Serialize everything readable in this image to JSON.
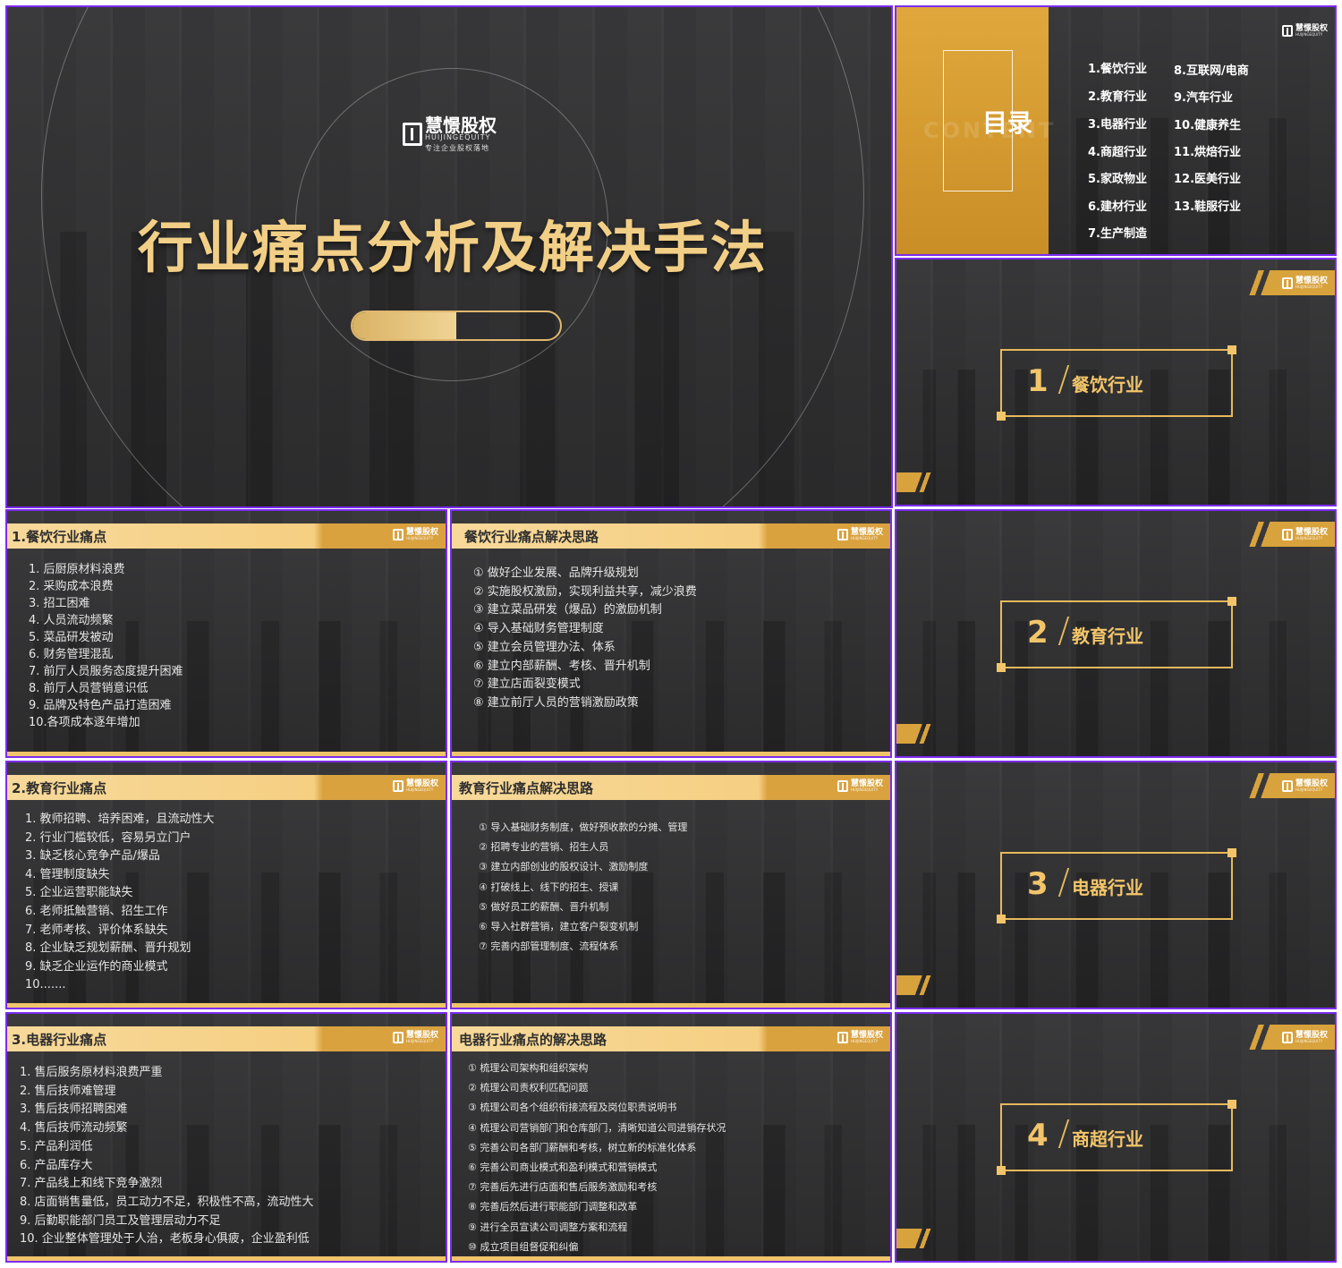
{
  "colors": {
    "accent": "#f2c56a",
    "border": "#7b2cf0",
    "header": "#f7d99a"
  },
  "brand": {
    "name": "慧憬股权",
    "en": "HUIJINGEQUITY",
    "tagline": "专注企业股权落地"
  },
  "title_slide": {
    "title": "行业痛点分析及解决手法",
    "progress": 0.5
  },
  "toc": {
    "title": "目录",
    "ghost": "CONTENT",
    "items": [
      "1.餐饮行业",
      "2.教育行业",
      "3.电器行业",
      "4.商超行业",
      "5.家政物业",
      "6.建材行业",
      "7.生产制造",
      "8.互联网/电商",
      "9.汽车行业",
      "10.健康养生",
      "11.烘焙行业",
      "12.医美行业",
      "13.鞋服行业"
    ]
  },
  "sections": [
    {
      "num": "1",
      "label": "餐饮行业"
    },
    {
      "num": "2",
      "label": "教育行业"
    },
    {
      "num": "3",
      "label": "电器行业"
    },
    {
      "num": "4",
      "label": "商超行业"
    }
  ],
  "catering_pain": {
    "title": "1.餐饮行业痛点",
    "items": [
      "1. 后厨原材料浪费",
      "2. 采购成本浪费",
      "3. 招工困难",
      "4. 人员流动频繁",
      "5. 菜品研发被动",
      "6. 财务管理混乱",
      "7. 前厅人员服务态度提升困难",
      "8. 前厅人员营销意识低",
      "9. 品牌及特色产品打造困难",
      "10.各项成本逐年增加"
    ]
  },
  "catering_solution": {
    "title": "餐饮行业痛点解决思路",
    "items": [
      "① 做好企业发展、品牌升级规划",
      "② 实施股权激励，实现利益共享，减少浪费",
      "③ 建立菜品研发（爆品）的激励机制",
      "④ 导入基础财务管理制度",
      "⑤ 建立会员管理办法、体系",
      "⑥ 建立内部薪酬、考核、晋升机制",
      "⑦ 建立店面裂变模式",
      "⑧ 建立前厅人员的营销激励政策"
    ]
  },
  "education_pain": {
    "title": "2.教育行业痛点",
    "items": [
      "1. 教师招聘、培养困难，且流动性大",
      "2. 行业门槛较低，容易另立门户",
      "3. 缺乏核心竞争产品/爆品",
      "4. 管理制度缺失",
      "5. 企业运营职能缺失",
      "6. 老师抵触营销、招生工作",
      "7. 老师考核、评价体系缺失",
      "8. 企业缺乏规划薪酬、晋升规划",
      "9. 缺乏企业运作的商业模式",
      "10.......  "
    ]
  },
  "education_solution": {
    "title": "教育行业痛点解决思路",
    "items": [
      "① 导入基础财务制度，做好预收款的分摊、管理",
      "② 招聘专业的营销、招生人员",
      "③ 建立内部创业的股权设计、激励制度",
      "④ 打破线上、线下的招生、授课",
      "⑤ 做好员工的薪酬、晋升机制",
      "⑥ 导入社群营销，建立客户裂变机制",
      "⑦ 完善内部管理制度、流程体系"
    ]
  },
  "appliance_pain": {
    "title": "3.电器行业痛点",
    "items": [
      "1. 售后服务原材料浪费严重",
      "2. 售后技师难管理",
      "3. 售后技师招聘困难",
      "4. 售后技师流动频繁",
      "5. 产品利润低",
      "6. 产品库存大",
      "7. 产品线上和线下竞争激烈",
      "8. 店面销售量低，员工动力不足，积极性不高，流动性大",
      "9. 后勤职能部门员工及管理层动力不足",
      "10. 企业整体管理处于人治，老板身心俱疲，企业盈利低"
    ]
  },
  "appliance_solution": {
    "title": "电器行业痛点的解决思路",
    "items": [
      "① 梳理公司架构和组织架构",
      "② 梳理公司责权利匹配问题",
      "③ 梳理公司各个组织衔接流程及岗位职责说明书",
      "④ 梳理公司营销部门和仓库部门，清晰知道公司进销存状况",
      "⑤ 完善公司各部门薪酬和考核，树立新的标准化体系",
      "⑥ 完善公司商业模式和盈利模式和营销模式",
      "⑦ 完善后先进行店面和售后服务激励和考核",
      "⑧ 完善后然后进行职能部门调整和改革",
      "⑨ 进行全员宣读公司调整方案和流程",
      "⑩ 成立项目组督促和纠偏"
    ]
  }
}
